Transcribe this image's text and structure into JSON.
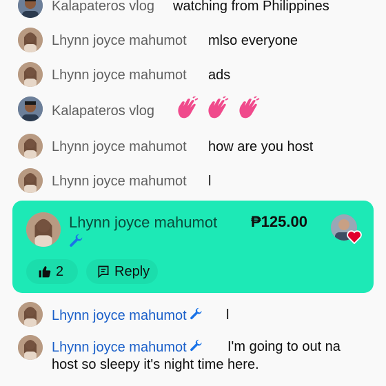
{
  "colors": {
    "background": "#f9f9f9",
    "superchat_bg": "#1de9b6",
    "moderator_name": "#1a5fc9",
    "author_name": "#606060",
    "heart": "#e1002d"
  },
  "messages": [
    {
      "author": "Kalapateros vlog",
      "text": "watching from Philippines",
      "moderator": false
    },
    {
      "author": "Lhynn joyce mahumot",
      "text": "mlso everyone",
      "moderator": false
    },
    {
      "author": "Lhynn joyce mahumot",
      "text": "ads",
      "moderator": false
    },
    {
      "author": "Kalapateros vlog",
      "text": "",
      "emoji": [
        "waving-hand-emoji",
        "waving-hand-emoji",
        "waving-hand-emoji"
      ],
      "moderator": false
    },
    {
      "author": "Lhynn joyce mahumot",
      "text": "how are you host",
      "moderator": false
    },
    {
      "author": "Lhynn joyce mahumot",
      "text": "l",
      "moderator": false
    }
  ],
  "superchat": {
    "author": "Lhynn joyce mahumot",
    "amount": "₱125.00",
    "like_count": "2",
    "reply_label": "Reply",
    "icons": [
      "wrench-icon",
      "thumbs-up-icon",
      "reply-icon",
      "heart-icon"
    ]
  },
  "after_messages": [
    {
      "author": "Lhynn joyce mahumot",
      "text": "l",
      "moderator": true
    },
    {
      "author": "Lhynn joyce mahumot",
      "text_line1": "I'm going to out na",
      "text_line2": "host so sleepy it's night time here.",
      "moderator": true
    }
  ]
}
